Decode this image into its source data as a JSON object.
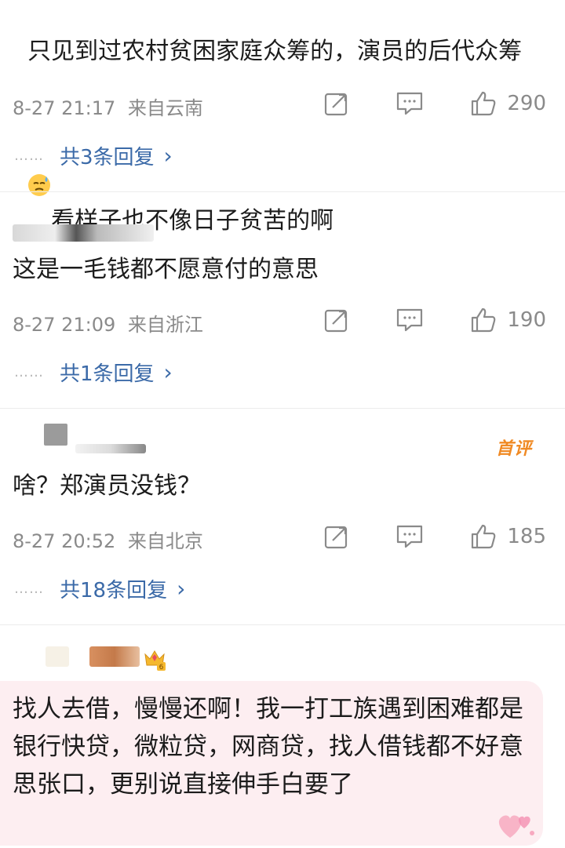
{
  "comments": [
    {
      "text": "只见到过农村贫困家庭众筹的，演员的后代众筹",
      "text_tail": "看样子也不像日子贫苦的啊",
      "emoji": "sweat-face-emoji",
      "time": "8-27 21:17",
      "location": "来自云南",
      "likes": "290",
      "replies": "共3条回复"
    },
    {
      "text": "这是一毛钱都不愿意付的意思",
      "time": "8-27 21:09",
      "location": "来自浙江",
      "likes": "190",
      "replies": "共1条回复"
    },
    {
      "text": "啥？郑演员没钱？",
      "badge": "首评",
      "time": "8-27 20:52",
      "location": "来自北京",
      "likes": "185",
      "replies": "共18条回复"
    },
    {
      "text": "找人去借，慢慢还啊！我一打工族遇到困难都是银行快贷，微粒贷，网商贷，找人借钱都不好意思张口，更别说直接伸手白要了",
      "user_badge_level": "6"
    }
  ],
  "icons": {
    "repost": "repost-icon",
    "comment": "comment-icon",
    "like": "like-icon",
    "chevron": "chevron-right-icon"
  },
  "colors": {
    "link": "#3b6aa8",
    "meta": "#8a8a8a",
    "badge_first": "#f08a24",
    "bubble_bg": "#fdeef1"
  },
  "reply_dots": "……",
  "chevron_glyph": "›"
}
